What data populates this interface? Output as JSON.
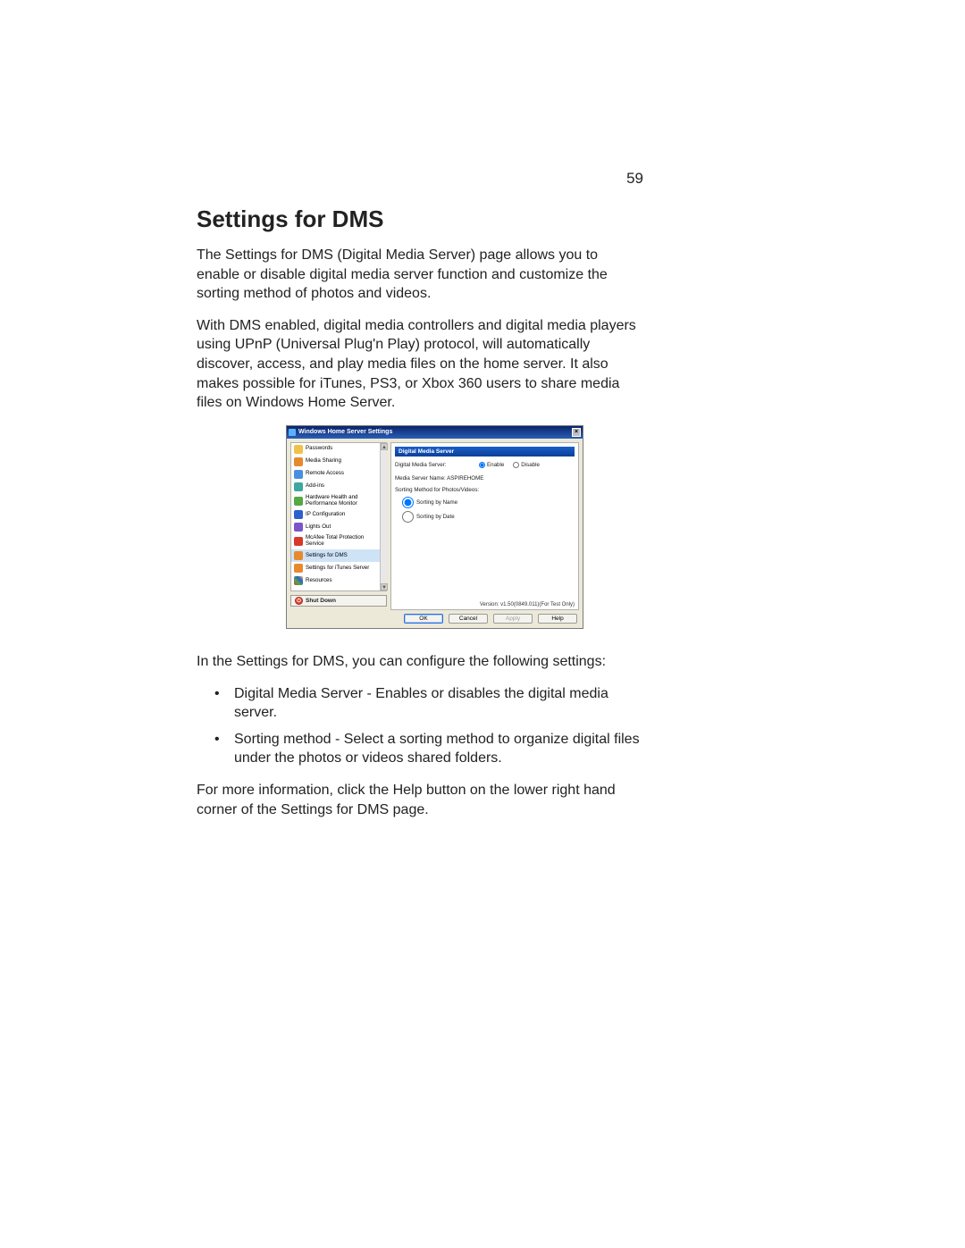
{
  "page_number": "59",
  "heading": "Settings for DMS",
  "para1": "The Settings for DMS (Digital Media Server) page allows you to enable or disable digital media server function and customize the sorting method of photos and videos.",
  "para2": "With DMS enabled, digital media controllers and digital media players using UPnP (Universal Plug'n Play) protocol, will automatically discover, access, and play media files on the home server. It also makes possible for iTunes, PS3, or Xbox 360 users to share media files on Windows Home Server.",
  "para3": "In the Settings for DMS, you can configure the following settings:",
  "bullets": [
    "Digital Media Server - Enables or disables the digital media server.",
    "Sorting method - Select a sorting method to organize digital files under the photos or videos shared folders."
  ],
  "para4": "For more information, click the Help button on the lower right hand corner of the Settings for DMS page.",
  "dialog": {
    "title": "Windows Home Server Settings",
    "sidebar": {
      "items": [
        {
          "label": "Passwords"
        },
        {
          "label": "Media Sharing"
        },
        {
          "label": "Remote Access"
        },
        {
          "label": "Add-ins"
        },
        {
          "label": "Hardware Health and Performance Monitor"
        },
        {
          "label": "IP Configuration"
        },
        {
          "label": "Lights Out"
        },
        {
          "label": "McAfee Total Protection Service"
        },
        {
          "label": "Settings for DMS"
        },
        {
          "label": "Settings for iTunes Server"
        },
        {
          "label": "Resources"
        }
      ],
      "shutdown": "Shut Down"
    },
    "panel": {
      "header": "Digital Media Server",
      "row_label": "Digital Media Server:",
      "enable": "Enable",
      "disable": "Disable",
      "server_name_label": "Media Server Name:",
      "server_name_value": "ASPIREHOME",
      "sort_label": "Sorting Method for Photos/Videos:",
      "sort_by_name": "Sorting by Name",
      "sort_by_date": "Sorting by Date",
      "version": "Version: v1.50(0849.011)(For Test Only)"
    },
    "buttons": {
      "ok": "OK",
      "cancel": "Cancel",
      "apply": "Apply",
      "help": "Help"
    }
  }
}
